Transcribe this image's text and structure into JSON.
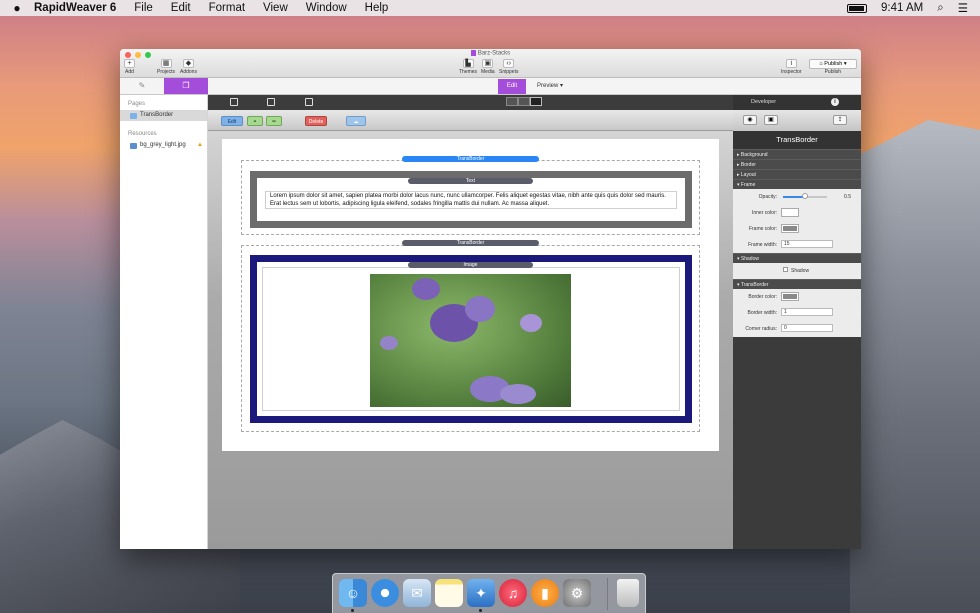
{
  "menubar": {
    "app_name": "RapidWeaver 6",
    "menus": [
      "File",
      "Edit",
      "Format",
      "View",
      "Window",
      "Help"
    ],
    "clock": "9:41 AM"
  },
  "window": {
    "title": "Barz-Stacks",
    "toolbar_left": [
      {
        "label": "Add",
        "glyph": "+"
      },
      {
        "label": "Projects",
        "glyph": "▦"
      },
      {
        "label": "Addons",
        "glyph": "◆"
      }
    ],
    "toolbar_center": [
      {
        "label": "Themes",
        "glyph": "▙"
      },
      {
        "label": "Media",
        "glyph": "▣"
      },
      {
        "label": "Snippets",
        "glyph": "‹›"
      }
    ],
    "inspector_label": "Inspector",
    "publish_button": "Publish",
    "publish_label": "Publish",
    "mode_edit": "Edit",
    "mode_preview": "Preview"
  },
  "sidebar": {
    "pages_heading": "Pages",
    "pages": [
      {
        "label": "TransBorder"
      }
    ],
    "resources_heading": "Resources",
    "resources": [
      {
        "label": "bg_grey_light.jpg",
        "warning": "▲"
      }
    ]
  },
  "stacks": {
    "buttons": {
      "edit": "Edit",
      "delete": "Delete"
    },
    "transborder_label": "TransBorder",
    "text_label": "Text",
    "image_label": "Image",
    "body_text": "Lorem ipsum dolor sit amet, sapien platea morbi dolor lacus nunc, nunc ullamcorper. Felis aliquet egestas vitae, nibh ante quis quis dolor sed mauris. Erat lectus sem ut lobortis, adipiscing ligula eleifend, sodales fringilla mattis dui nullam. Ac massa aliquet."
  },
  "inspector": {
    "developer": "Developer",
    "title": "TransBorder",
    "sections": {
      "background": "Background",
      "border": "Border",
      "layout": "Layout",
      "frame": "Frame",
      "shadow": "Shadow",
      "transborder": "TransBorder"
    },
    "frame": {
      "opacity_label": "Opacity:",
      "opacity_value": "0.5",
      "opacity": 0.5,
      "inner_color_label": "Inner color:",
      "inner_color": "#ffffff",
      "frame_color_label": "Frame color:",
      "frame_color": "#8a8a8a",
      "frame_width_label": "Frame width:",
      "frame_width": "15"
    },
    "shadow": {
      "checkbox_label": "Shadow"
    },
    "transborder": {
      "border_color_label": "Border color:",
      "border_color": "#8a8a8a",
      "border_width_label": "Border width:",
      "border_width": "1",
      "corner_radius_label": "Corner radius:",
      "corner_radius": "0"
    }
  },
  "colors": {
    "accent": "#a44ddb",
    "pill_blue": "#2a86f5",
    "image_frame": "#1b1a7a",
    "text_frame": "#6c6c6c"
  },
  "dock": [
    "finder-icon",
    "safari-icon",
    "mail-icon",
    "notes-icon",
    "rapidweaver-icon",
    "itunes-icon",
    "ibooks-icon",
    "system-preferences-icon",
    "trash-icon"
  ]
}
